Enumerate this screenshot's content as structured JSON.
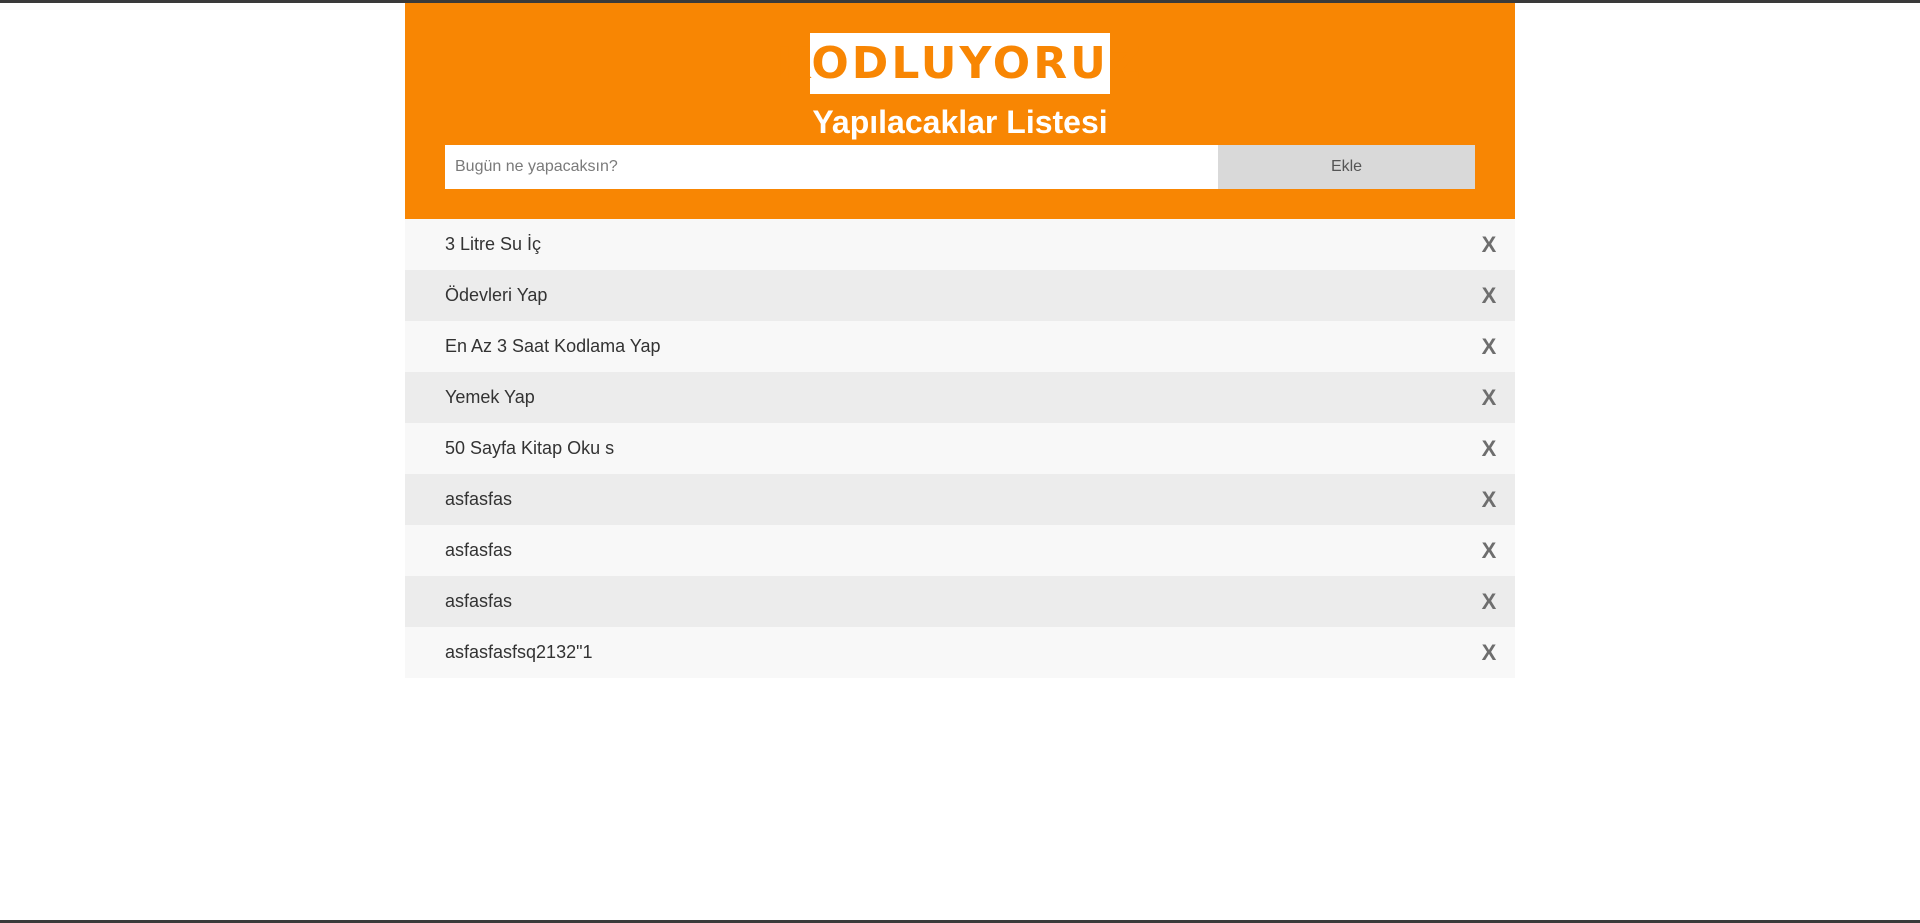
{
  "header": {
    "logo_text": "KODLUYORUZ",
    "title": "Yapılacaklar Listesi"
  },
  "form": {
    "placeholder": "Bugün ne yapacaksın?",
    "value": "",
    "add_label": "Ekle"
  },
  "list": {
    "items": [
      {
        "text": "3 Litre Su İç",
        "remove_icon": "X"
      },
      {
        "text": "Ödevleri Yap",
        "remove_icon": "X"
      },
      {
        "text": "En Az 3 Saat Kodlama Yap",
        "remove_icon": "X"
      },
      {
        "text": "Yemek Yap",
        "remove_icon": "X"
      },
      {
        "text": "50 Sayfa Kitap Oku s",
        "remove_icon": "X"
      },
      {
        "text": "asfasfas",
        "remove_icon": "X"
      },
      {
        "text": "asfasfas",
        "remove_icon": "X"
      },
      {
        "text": "asfasfas",
        "remove_icon": "X"
      },
      {
        "text": "asfasfasfsq2132\"1",
        "remove_icon": "X"
      }
    ]
  },
  "colors": {
    "brand": "#f88603",
    "button_bg": "#d9d9d9",
    "row_odd": "#f8f8f8",
    "row_even": "#ececec"
  }
}
